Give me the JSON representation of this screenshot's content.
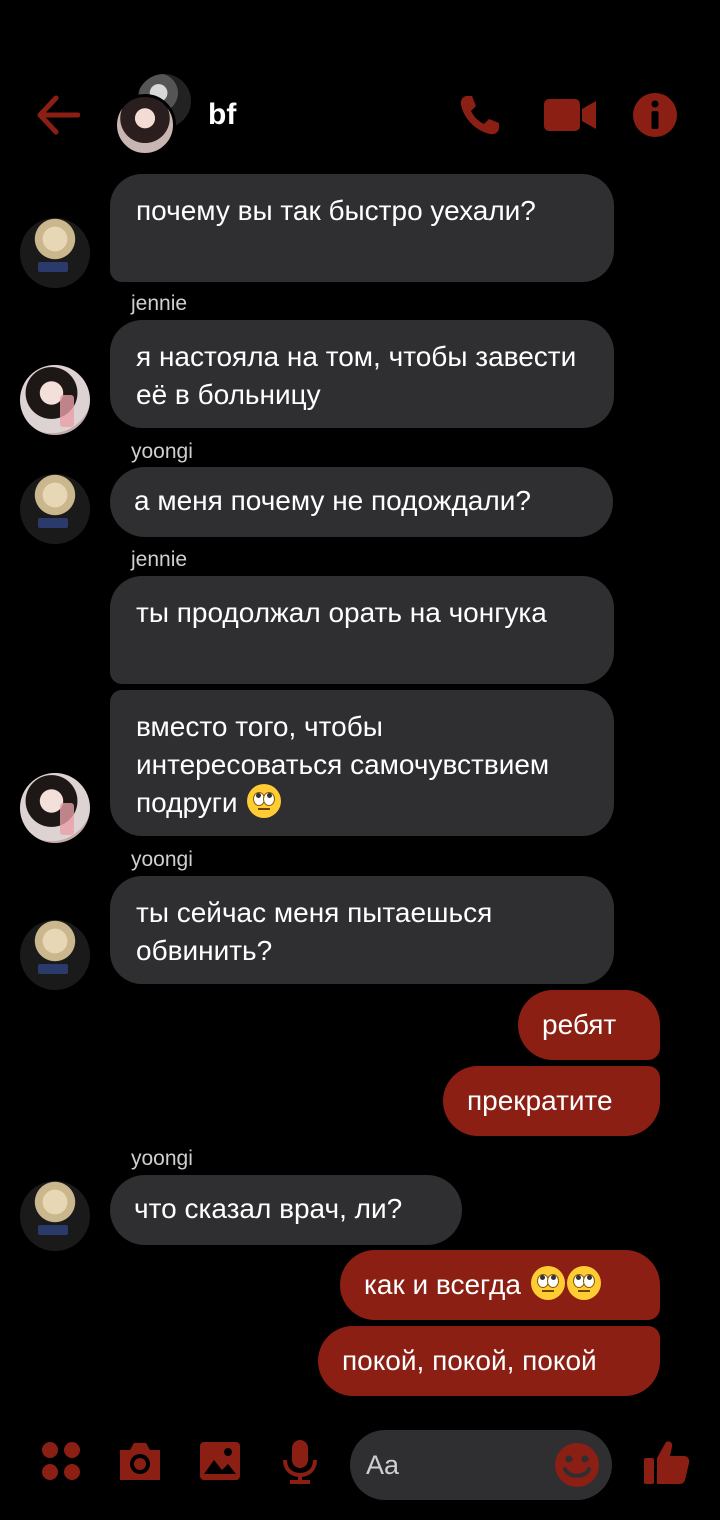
{
  "header": {
    "title": "bf",
    "icons": [
      "back-arrow-icon",
      "phone-icon",
      "video-icon",
      "info-icon"
    ]
  },
  "colors": {
    "accent": "#8b1f14",
    "incoming_bubble": "#2f2e31",
    "background": "#000000"
  },
  "messages": [
    {
      "from": "in",
      "text": "почему вы так быстро уехали?"
    },
    {
      "from": "in",
      "sender": "jennie",
      "text": "я настояла на том, чтобы завести её в больницу"
    },
    {
      "from": "in",
      "sender": "yoongi",
      "text": "а меня почему не подождали?"
    },
    {
      "from": "in",
      "sender": "jennie",
      "text": "ты продолжал орать на чонгука"
    },
    {
      "from": "in",
      "text": "вместо того, чтобы интересоваться самочувствием подруги"
    },
    {
      "from": "in",
      "sender": "yoongi",
      "text": "ты сейчас меня пытаешься обвинить?"
    },
    {
      "from": "out",
      "text": "ребят"
    },
    {
      "from": "out",
      "text": "прекратите"
    },
    {
      "from": "in",
      "sender": "yoongi",
      "text": "что сказал врач, ли?"
    },
    {
      "from": "out",
      "text": "как и всегда"
    },
    {
      "from": "out",
      "text": "покой, покой, покой"
    }
  ],
  "composer": {
    "placeholder": "Aa"
  },
  "toolbar": {
    "icons": [
      "menu-dots-icon",
      "camera-icon",
      "gallery-icon",
      "mic-icon",
      "emoji-icon",
      "like-icon"
    ]
  }
}
